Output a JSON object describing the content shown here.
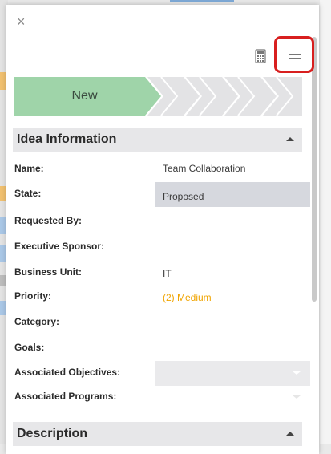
{
  "process": {
    "active_stage": "New",
    "active_color": "#9fd4a9",
    "inactive_color": "#e3e3e5",
    "remaining_stages": 4
  },
  "toolbar": {
    "close_glyph": "×",
    "calculator_icon": "calculator-icon",
    "menu_icon": "hamburger-menu-icon",
    "highlight_color": "#d81f1f"
  },
  "sections": {
    "idea_information": "Idea Information",
    "description": "Description"
  },
  "fields": [
    {
      "label": "Name:",
      "value": "Team Collaboration"
    },
    {
      "label": "State:",
      "value": "Proposed"
    },
    {
      "label": "Requested By:",
      "value": ""
    },
    {
      "label": "Executive Sponsor:",
      "value": ""
    },
    {
      "label": "Business Unit:",
      "value": "IT"
    },
    {
      "label": "Priority:",
      "value": "(2) Medium",
      "color": "#f0a400"
    },
    {
      "label": "Category:",
      "value": ""
    },
    {
      "label": "Goals:",
      "value": ""
    },
    {
      "label": "Associated Objectives:",
      "value": ""
    },
    {
      "label": "Associated Programs:",
      "value": ""
    }
  ]
}
